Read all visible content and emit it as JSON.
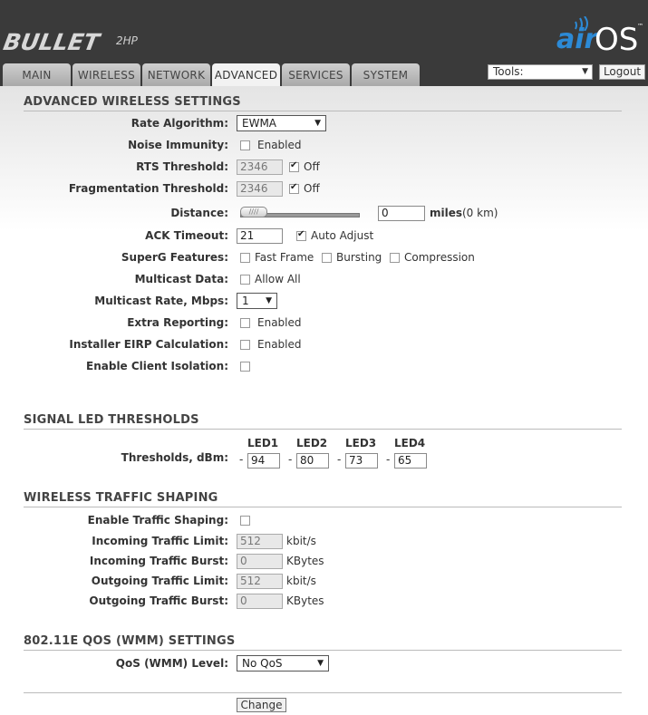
{
  "header": {
    "brand": "BULLET",
    "brand_sub": "2HP",
    "logo_air": "air",
    "logo_os": "OS",
    "logo_tm": "™"
  },
  "tabs": [
    {
      "label": "MAIN"
    },
    {
      "label": "WIRELESS"
    },
    {
      "label": "NETWORK"
    },
    {
      "label": "ADVANCED",
      "active": true
    },
    {
      "label": "SERVICES"
    },
    {
      "label": "SYSTEM"
    }
  ],
  "tools": {
    "label": "Tools:",
    "logout": "Logout"
  },
  "advanced_wireless": {
    "title": "ADVANCED WIRELESS SETTINGS",
    "rate_algorithm": {
      "label": "Rate Algorithm:",
      "value": "EWMA"
    },
    "noise_immunity": {
      "label": "Noise Immunity:",
      "option": "Enabled",
      "checked": false
    },
    "rts_threshold": {
      "label": "RTS Threshold:",
      "value": "2346",
      "off_label": "Off",
      "off_checked": true
    },
    "frag_threshold": {
      "label": "Fragmentation Threshold:",
      "value": "2346",
      "off_label": "Off",
      "off_checked": true
    },
    "distance": {
      "label": "Distance:",
      "value": "0",
      "unit": "miles",
      "km_text": "(0 km)",
      "slider_value": 0
    },
    "ack_timeout": {
      "label": "ACK Timeout:",
      "value": "21",
      "auto_label": "Auto Adjust",
      "auto_checked": true
    },
    "superg": {
      "label": "SuperG Features:",
      "fast_frame": "Fast Frame",
      "bursting": "Bursting",
      "compression": "Compression"
    },
    "multicast_data": {
      "label": "Multicast Data:",
      "option": "Allow All"
    },
    "multicast_rate": {
      "label": "Multicast Rate, Mbps:",
      "value": "1"
    },
    "extra_reporting": {
      "label": "Extra Reporting:",
      "option": "Enabled"
    },
    "installer_eirp": {
      "label": "Installer EIRP Calculation:",
      "option": "Enabled"
    },
    "client_isolation": {
      "label": "Enable Client Isolation:"
    }
  },
  "signal_led": {
    "title": "SIGNAL LED THRESHOLDS",
    "label": "Thresholds, dBm:",
    "leds": [
      {
        "name": "LED1",
        "value": "94"
      },
      {
        "name": "LED2",
        "value": "80"
      },
      {
        "name": "LED3",
        "value": "73"
      },
      {
        "name": "LED4",
        "value": "65"
      }
    ],
    "dash": "-"
  },
  "traffic_shaping": {
    "title": "WIRELESS TRAFFIC SHAPING",
    "enable_label": "Enable Traffic Shaping:",
    "incoming_limit": {
      "label": "Incoming Traffic Limit:",
      "value": "512",
      "unit": "kbit/s"
    },
    "incoming_burst": {
      "label": "Incoming Traffic Burst:",
      "value": "0",
      "unit": "KBytes"
    },
    "outgoing_limit": {
      "label": "Outgoing Traffic Limit:",
      "value": "512",
      "unit": "kbit/s"
    },
    "outgoing_burst": {
      "label": "Outgoing Traffic Burst:",
      "value": "0",
      "unit": "KBytes"
    }
  },
  "qos": {
    "title": "802.11E QOS (WMM) SETTINGS",
    "label": "QoS (WMM) Level:",
    "value": "No QoS"
  },
  "change_button": "Change"
}
